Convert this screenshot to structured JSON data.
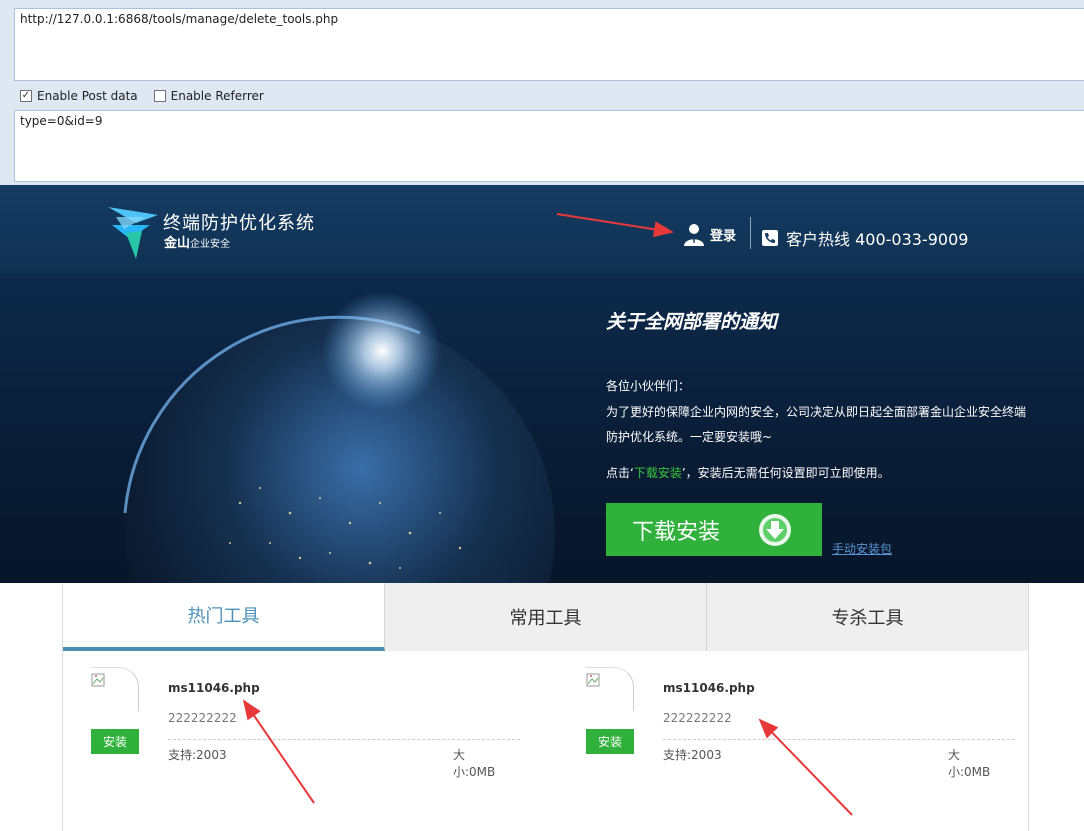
{
  "hackbar": {
    "url": "http://127.0.0.1:6868/tools/manage/delete_tools.php",
    "enable_post_label": "Enable Post data",
    "enable_post_checked": true,
    "enable_referrer_label": "Enable Referrer",
    "enable_referrer_checked": false,
    "post_data": "type=0&id=9"
  },
  "header": {
    "logo_title": "终端防护优化系统",
    "logo_brand": "金山",
    "logo_brand_sub": "企业安全",
    "login_label": "登录",
    "hotline_label": "客户热线 400-033-9009",
    "icons": [
      "logo-icon",
      "user-icon",
      "phone-icon"
    ]
  },
  "banner": {
    "notice_title": "关于全网部署的通知",
    "greeting": "各位小伙伴们：",
    "body": "为了更好的保障企业内网的安全，公司决定从即日起全面部署金山企业安全终端防护优化系统。一定要安装哦~",
    "tip_prefix": "点击‘",
    "tip_highlight": "下载安装",
    "tip_suffix": "’，安装后无需任何设置即可立即使用。",
    "download_label": "下载安装",
    "manual_link": "手动安装包",
    "highlight_color": "#3cc83c",
    "button_color": "#2fb13c"
  },
  "tabs": [
    {
      "label": "热门工具",
      "active": true
    },
    {
      "label": "常用工具",
      "active": false
    },
    {
      "label": "专杀工具",
      "active": false
    }
  ],
  "tools": [
    {
      "name": "ms11046.php",
      "desc": "222222222",
      "support": "支持:2003",
      "size": "大小:0MB",
      "install_label": "安装"
    },
    {
      "name": "ms11046.php",
      "desc": "222222222",
      "support": "支持:2003",
      "size": "大小:0MB",
      "install_label": "安装"
    }
  ],
  "colors": {
    "active_tab": "#4a90b8",
    "annotation_arrow": "#e8393a"
  }
}
